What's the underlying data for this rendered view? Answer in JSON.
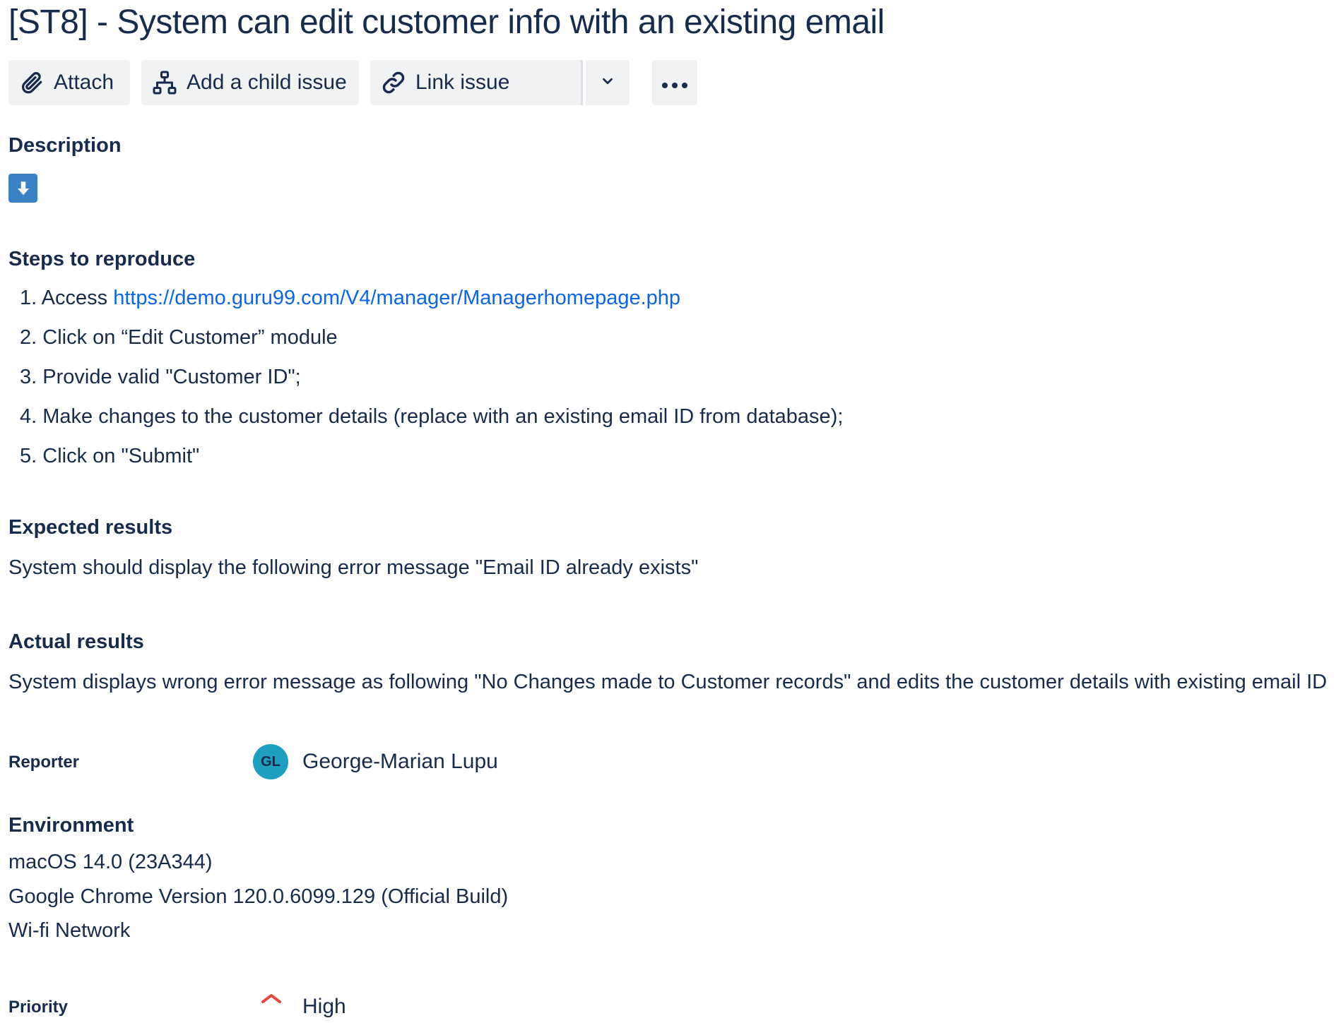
{
  "issue": {
    "title": "[ST8] - System can edit customer info with an existing email"
  },
  "toolbar": {
    "attach_label": "Attach",
    "child_label": "Add a child issue",
    "link_label": "Link issue"
  },
  "description": {
    "heading": "Description"
  },
  "steps": {
    "heading": "Steps to reproduce",
    "items": [
      {
        "num": "1.",
        "prefix": "Access ",
        "link": "https://demo.guru99.com/V4/manager/Managerhomepage.php"
      },
      {
        "num": "2.",
        "text": "Click on “Edit Customer” module"
      },
      {
        "num": "3.",
        "text": "Provide valid \"Customer ID\";"
      },
      {
        "num": "4.",
        "text": "Make changes to the customer details (replace with an existing email ID from database);"
      },
      {
        "num": "5.",
        "text": "Click on \"Submit\""
      }
    ]
  },
  "expected": {
    "heading": "Expected results",
    "text": "System should display the following error message \"Email ID already exists\""
  },
  "actual": {
    "heading": "Actual results",
    "text": "System displays wrong error message as following \"No Changes made to Customer records\" and edits the customer details with existing email ID"
  },
  "reporter": {
    "label": "Reporter",
    "initials": "GL",
    "name": "George-Marian Lupu",
    "avatar_color": "#1f9fbf"
  },
  "environment": {
    "heading": "Environment",
    "lines": [
      "macOS 14.0 (23A344)",
      "Google Chrome Version 120.0.6099.129 (Official Build)",
      "Wi-fi Network"
    ]
  },
  "priority": {
    "label": "Priority",
    "value": "High",
    "icon": "priority-high-icon",
    "color": "#e2483d"
  },
  "colors": {
    "link": "#0c66e4",
    "text": "#172b4d",
    "button_bg": "#f1f2f4",
    "description_icon_bg": "#3b82c4"
  }
}
